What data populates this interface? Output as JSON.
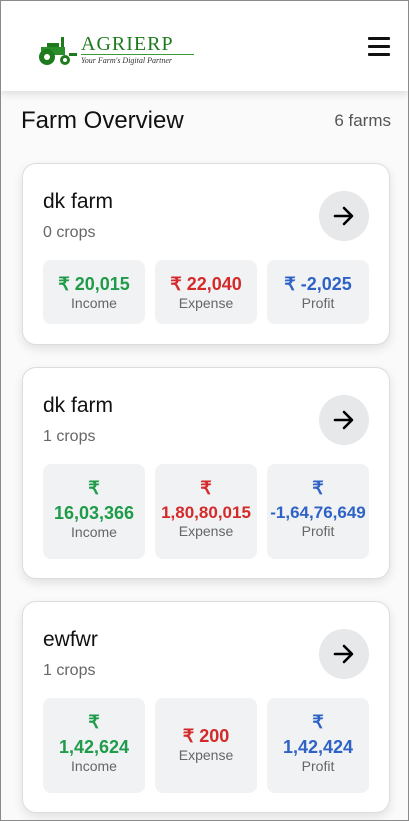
{
  "header": {
    "logo_title": "AGRIERP",
    "logo_tagline": "Your Farm's Digital Partner"
  },
  "page": {
    "title": "Farm Overview",
    "count": "6 farms"
  },
  "colors": {
    "income": "#1f9b4a",
    "expense": "#d42a2a",
    "profit": "#2f62c6",
    "brand": "#1d7a1d"
  },
  "icons": {
    "menu": "hamburger-menu-icon",
    "open": "arrow-right-icon",
    "logo": "tractor-icon"
  },
  "farms": [
    {
      "name": "dk farm",
      "crops": "0 crops",
      "income": "₹ 20,015",
      "expense": "₹ 22,040",
      "profit": "₹ -2,025",
      "income_label": "Income",
      "expense_label": "Expense",
      "profit_label": "Profit"
    },
    {
      "name": "dk farm",
      "crops": "1 crops",
      "income_symbol": "₹",
      "income": "16,03,366",
      "expense_symbol": "₹",
      "expense": "1,80,80,015",
      "profit_symbol": "₹",
      "profit": "-1,64,76,649",
      "income_label": "Income",
      "expense_label": "Expense",
      "profit_label": "Profit"
    },
    {
      "name": "ewfwr",
      "crops": "1 crops",
      "income_symbol": "₹",
      "income": "1,42,624",
      "expense": "₹ 200",
      "profit_symbol": "₹",
      "profit": "1,42,424",
      "income_label": "Income",
      "expense_label": "Expense",
      "profit_label": "Profit"
    }
  ]
}
